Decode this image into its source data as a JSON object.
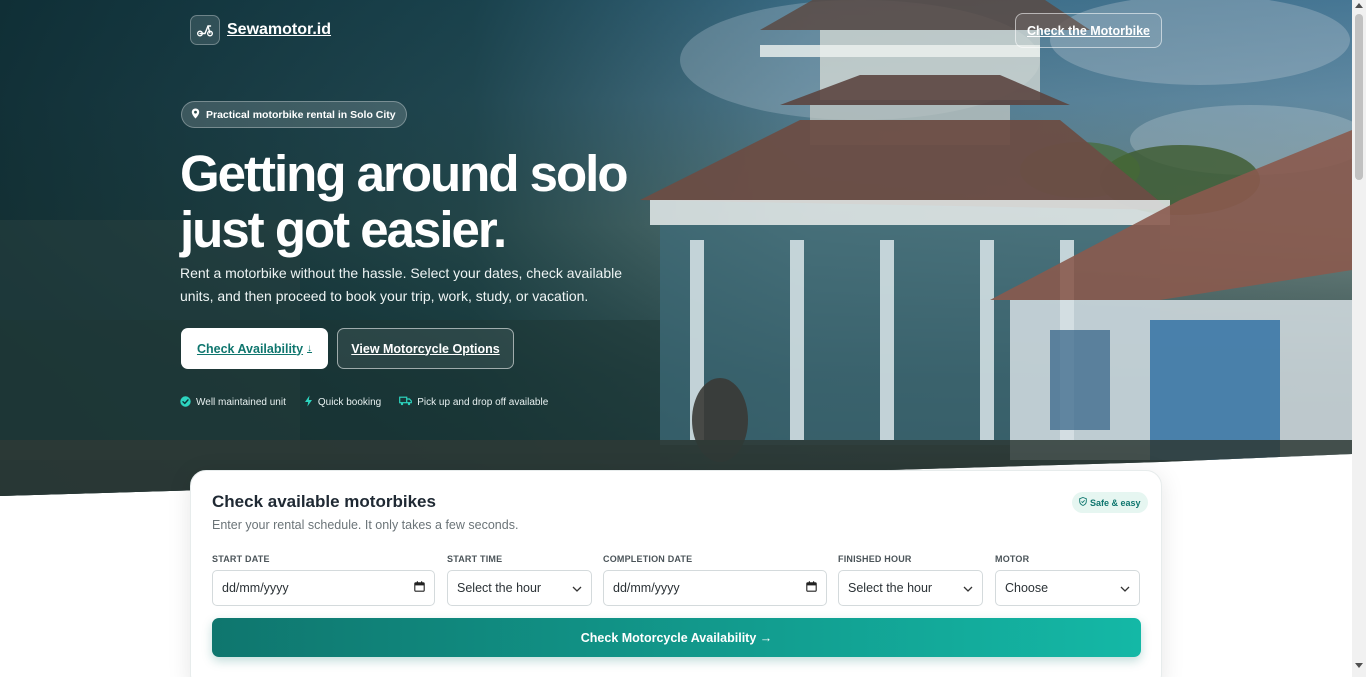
{
  "brand": {
    "name": "Sewamotor.id",
    "logo_icon": "scooter-icon"
  },
  "header": {
    "cta_label": "Check the Motorbike"
  },
  "hero": {
    "pill_text": "Practical motorbike rental in Solo City",
    "headline_line1": "Getting around solo",
    "headline_line2": "just got easier.",
    "subtext": "Rent a motorbike without the hassle. Select your dates, check available units, and then proceed to book your trip, work, study, or vacation.",
    "primary_button": "Check Availability",
    "primary_button_arrow": "↓",
    "secondary_button": "View Motorcycle Options",
    "features": [
      {
        "icon": "check-circle-icon",
        "label": "Well maintained unit"
      },
      {
        "icon": "lightning-icon",
        "label": "Quick booking"
      },
      {
        "icon": "truck-icon",
        "label": "Pick up and drop off available"
      }
    ]
  },
  "booking": {
    "title": "Check available motorbikes",
    "subtitle": "Enter your rental schedule. It only takes a few seconds.",
    "badge": "Safe & easy",
    "fields": {
      "start_date": {
        "label": "START DATE",
        "value": "dd/mm/yyyy"
      },
      "start_time": {
        "label": "START TIME",
        "value": "Select the hour"
      },
      "completion_date": {
        "label": "COMPLETION DATE",
        "value": "dd/mm/yyyy"
      },
      "finished_hour": {
        "label": "FINISHED HOUR",
        "value": "Select the hour"
      },
      "motor": {
        "label": "MOTOR",
        "value": "Choose"
      }
    },
    "submit_label": "Check Motorcycle Availability →"
  },
  "colors": {
    "accent": "#0f766e",
    "accent_light": "#14b8a6",
    "hero_dark": "#0d3236"
  }
}
